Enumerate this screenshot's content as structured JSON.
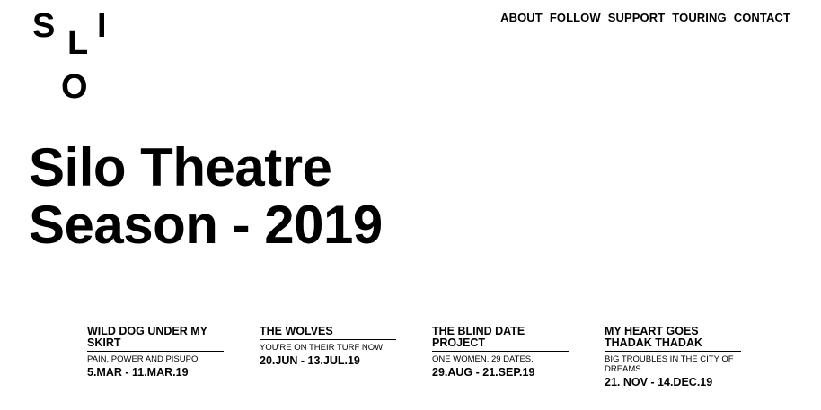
{
  "logo": {
    "letter_s": "S",
    "letter_l": "L",
    "letter_i": "I",
    "letter_o": "O"
  },
  "nav": {
    "items": [
      "ABOUT",
      "FOLLOW",
      "SUPPORT",
      "TOURING",
      "CONTACT"
    ]
  },
  "hero": {
    "line1": "Silo Theatre",
    "line2": "Season - 2019"
  },
  "shows": [
    {
      "title": "WILD DOG UNDER MY SKIRT",
      "tagline": "PAIN, POWER AND PISUPO",
      "dates": "5.MAR - 11.MAR.19"
    },
    {
      "title": "THE WOLVES",
      "tagline": "YOU'RE ON THEIR TURF NOW",
      "dates": "20.JUN - 13.JUL.19"
    },
    {
      "title": "THE BLIND DATE PROJECT",
      "tagline": "ONE WOMEN. 29 DATES.",
      "dates": "29.AUG - 21.SEP.19"
    },
    {
      "title": "MY HEART GOES THADAK THADAK",
      "tagline": "BIG TROUBLES IN THE CITY OF DREAMS",
      "dates": "21. NOV - 14.DEC.19"
    }
  ]
}
